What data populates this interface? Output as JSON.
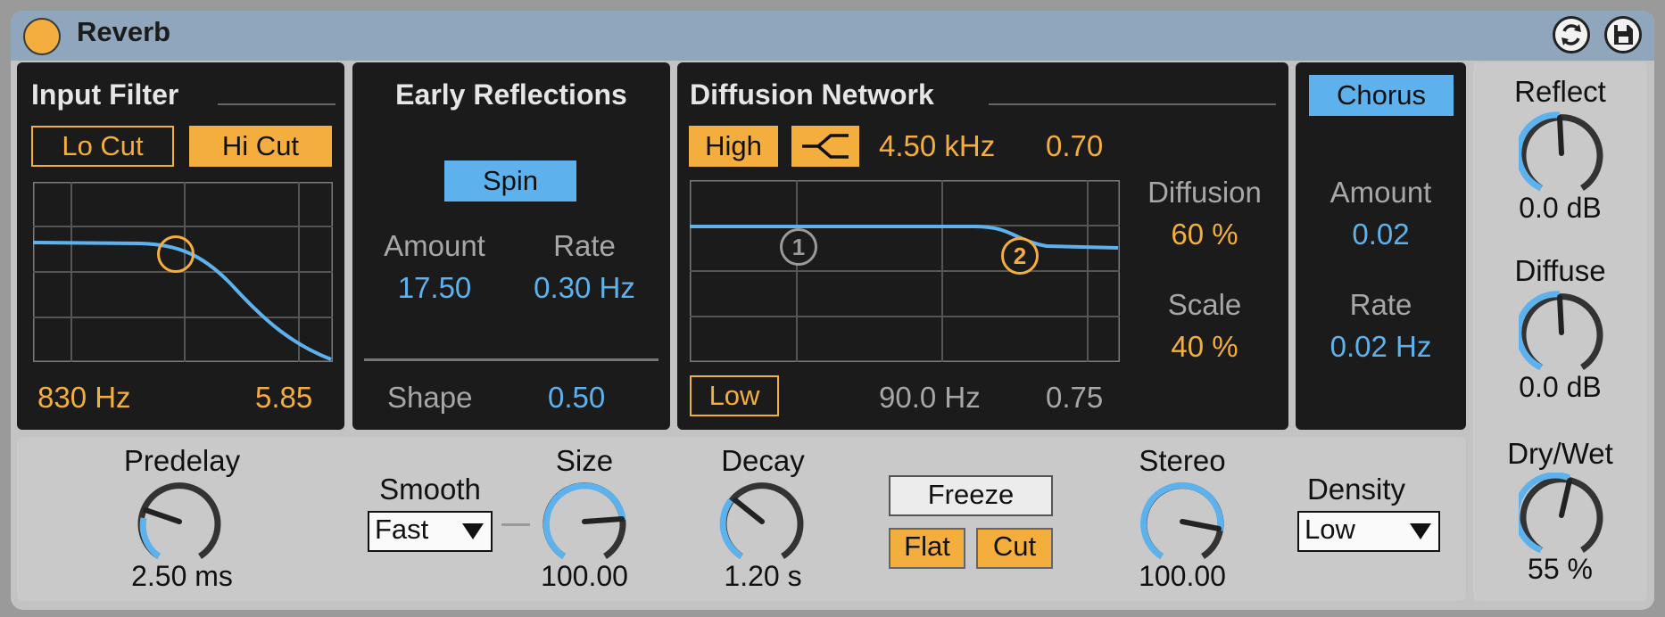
{
  "device": {
    "title": "Reverb",
    "accent": "#f4ae3e",
    "blue": "#5db2ee",
    "icons": [
      "power-icon",
      "hot-swap-icon",
      "save-icon"
    ]
  },
  "input_filter": {
    "title": "Input Filter",
    "lo_cut": "Lo Cut",
    "hi_cut": "Hi Cut",
    "freq": "830 Hz",
    "width": "5.85"
  },
  "early_reflections": {
    "title": "Early Reflections",
    "spin": "Spin",
    "amount_label": "Amount",
    "amount_value": "17.50",
    "rate_label": "Rate",
    "rate_value": "0.30 Hz",
    "shape_label": "Shape",
    "shape_value": "0.50"
  },
  "diffusion_network": {
    "title": "Diffusion Network",
    "high": "High",
    "high_freq": "4.50 kHz",
    "high_value": "0.70",
    "low": "Low",
    "low_freq": "90.0 Hz",
    "low_value": "0.75",
    "node1": "1",
    "node2": "2",
    "diffusion_label": "Diffusion",
    "diffusion_value": "60 %",
    "scale_label": "Scale",
    "scale_value": "40 %"
  },
  "chorus": {
    "title": "Chorus",
    "amount_label": "Amount",
    "amount_value": "0.02",
    "rate_label": "Rate",
    "rate_value": "0.02 Hz"
  },
  "bottom": {
    "predelay_label": "Predelay",
    "predelay_value": "2.50 ms",
    "smooth_label": "Smooth",
    "smooth_value": "Fast",
    "size_label": "Size",
    "size_value": "100.00",
    "decay_label": "Decay",
    "decay_value": "1.20 s",
    "freeze": "Freeze",
    "flat": "Flat",
    "cut": "Cut",
    "stereo_label": "Stereo",
    "stereo_value": "100.00",
    "density_label": "Density",
    "density_value": "Low"
  },
  "output": {
    "reflect_label": "Reflect",
    "reflect_value": "0.0 dB",
    "diffuse_label": "Diffuse",
    "diffuse_value": "0.0 dB",
    "drywet_label": "Dry/Wet",
    "drywet_value": "55 %"
  }
}
